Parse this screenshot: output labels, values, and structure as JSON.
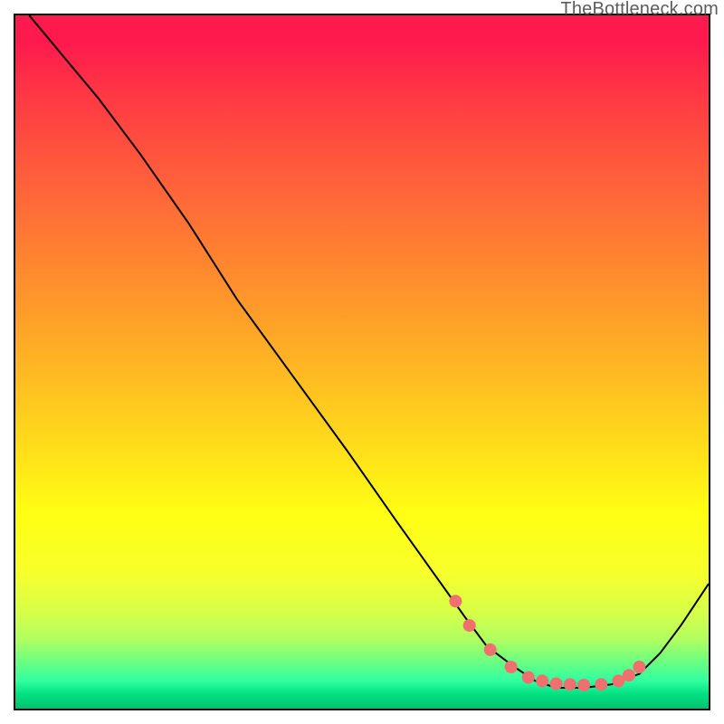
{
  "watermark": "TheBottleneck.com",
  "chart_data": {
    "type": "line",
    "title": "",
    "xlabel": "",
    "ylabel": "",
    "xlim": [
      0,
      100
    ],
    "ylim": [
      0,
      100
    ],
    "grid": false,
    "curve": {
      "x": [
        2,
        7,
        12,
        18,
        25,
        32,
        40,
        48,
        55,
        60,
        65,
        68,
        72,
        75,
        78,
        82,
        86,
        90,
        93,
        96,
        100
      ],
      "y": [
        100,
        94,
        88,
        80,
        70,
        59,
        48,
        37,
        27,
        20,
        13,
        9,
        6,
        4,
        3,
        3,
        3.5,
        5,
        8,
        12,
        18
      ]
    },
    "dots": {
      "x": [
        63.5,
        65.5,
        68.5,
        71.5,
        74.0,
        76.0,
        78.0,
        80.0,
        82.0,
        84.5,
        87.0,
        88.5,
        90.0
      ],
      "y": [
        15.5,
        12.0,
        8.5,
        6.0,
        4.5,
        4.0,
        3.6,
        3.5,
        3.4,
        3.5,
        4.0,
        4.8,
        6.0
      ]
    },
    "colors": {
      "curve": "#000000",
      "dot": "#f07070",
      "frame": "#000000"
    }
  }
}
